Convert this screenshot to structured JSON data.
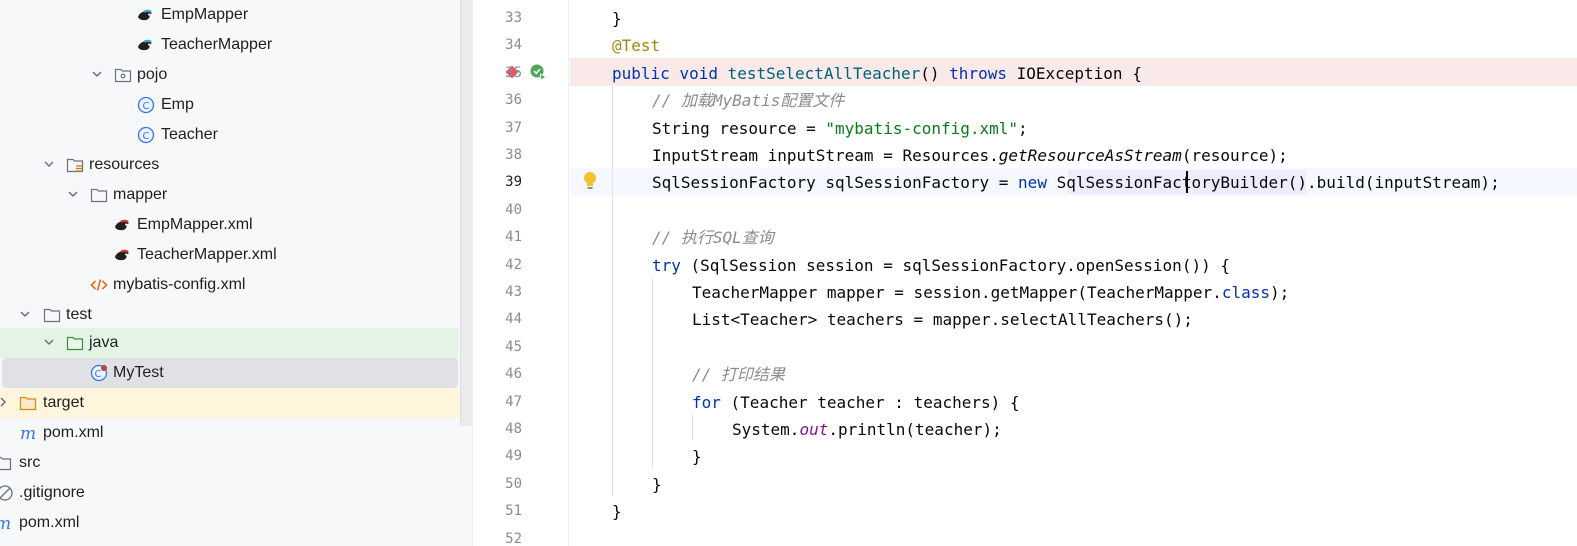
{
  "tree": {
    "items": [
      {
        "label": "EmpMapper",
        "icon": "mybatis-mapper-icon"
      },
      {
        "label": "TeacherMapper",
        "icon": "mybatis-mapper-icon"
      },
      {
        "label": "pojo",
        "icon": "package-icon"
      },
      {
        "label": "Emp",
        "icon": "class-icon"
      },
      {
        "label": "Teacher",
        "icon": "class-icon"
      },
      {
        "label": "resources",
        "icon": "resources-folder-icon"
      },
      {
        "label": "mapper",
        "icon": "folder-icon"
      },
      {
        "label": "EmpMapper.xml",
        "icon": "mybatis-xml-icon"
      },
      {
        "label": "TeacherMapper.xml",
        "icon": "mybatis-xml-icon"
      },
      {
        "label": "mybatis-config.xml",
        "icon": "xml-icon"
      },
      {
        "label": "test",
        "icon": "folder-icon"
      },
      {
        "label": "java",
        "icon": "test-sources-folder-icon"
      },
      {
        "label": "MyTest",
        "icon": "test-class-icon"
      },
      {
        "label": "target",
        "icon": "excluded-folder-icon"
      },
      {
        "label": "pom.xml",
        "icon": "maven-icon"
      },
      {
        "label": "src",
        "icon": "folder-icon"
      },
      {
        "label": ".gitignore",
        "icon": "ignore-file-icon"
      },
      {
        "label": "pom.xml",
        "icon": "maven-icon"
      }
    ]
  },
  "editor": {
    "line_numbers": [
      "33",
      "34",
      "35",
      "36",
      "37",
      "38",
      "39",
      "40",
      "41",
      "42",
      "43",
      "44",
      "45",
      "46",
      "47",
      "48",
      "49",
      "50",
      "51",
      "52"
    ],
    "current_line": "39",
    "lines": [
      {
        "t": [
          {
            "s": "}",
            "c": ""
          }
        ]
      },
      {
        "t": [
          {
            "s": "@Test",
            "c": "ann"
          }
        ]
      },
      {
        "t": [
          {
            "s": "public",
            "c": "kw"
          },
          {
            "s": " ",
            "c": ""
          },
          {
            "s": "void",
            "c": "kw"
          },
          {
            "s": " ",
            "c": ""
          },
          {
            "s": "testSelectAllTeacher",
            "c": "fn"
          },
          {
            "s": "() ",
            "c": ""
          },
          {
            "s": "throws",
            "c": "kw"
          },
          {
            "s": " IOException {",
            "c": ""
          }
        ]
      },
      {
        "t": [
          {
            "s": "// 加载MyBatis配置文件",
            "c": "cm"
          }
        ]
      },
      {
        "t": [
          {
            "s": "String resource = ",
            "c": ""
          },
          {
            "s": "\"mybatis-config.xml\"",
            "c": "str"
          },
          {
            "s": ";",
            "c": ""
          }
        ]
      },
      {
        "t": [
          {
            "s": "InputStream inputStream = Resources.",
            "c": ""
          },
          {
            "s": "getResourceAsStream",
            "c": "st"
          },
          {
            "s": "(resource);",
            "c": ""
          }
        ]
      },
      {
        "t": [
          {
            "s": "SqlSessionFactory sqlSessionFactory = ",
            "c": ""
          },
          {
            "s": "new",
            "c": "kw"
          },
          {
            "s": " SqlSessionFactoryBuilder().build(inputStream);",
            "c": ""
          }
        ]
      },
      {
        "t": []
      },
      {
        "t": [
          {
            "s": "// 执行SQL查询",
            "c": "cm"
          }
        ]
      },
      {
        "t": [
          {
            "s": "try",
            "c": "kw"
          },
          {
            "s": " (SqlSession session = sqlSessionFactory.openSession()) {",
            "c": ""
          }
        ]
      },
      {
        "t": [
          {
            "s": "TeacherMapper mapper = session.getMapper(TeacherMapper.",
            "c": ""
          },
          {
            "s": "class",
            "c": "kw"
          },
          {
            "s": ");",
            "c": ""
          }
        ]
      },
      {
        "t": [
          {
            "s": "List<Teacher> teachers = mapper.selectAllTeachers();",
            "c": ""
          }
        ]
      },
      {
        "t": []
      },
      {
        "t": [
          {
            "s": "// 打印结果",
            "c": "cm"
          }
        ]
      },
      {
        "t": [
          {
            "s": "for",
            "c": "kw"
          },
          {
            "s": " (Teacher teacher : teachers) {",
            "c": ""
          }
        ]
      },
      {
        "t": [
          {
            "s": "System.",
            "c": ""
          },
          {
            "s": "out",
            "c": "fld"
          },
          {
            "s": ".println(teacher);",
            "c": ""
          }
        ]
      },
      {
        "t": [
          {
            "s": "}",
            "c": ""
          }
        ]
      },
      {
        "t": [
          {
            "s": "}",
            "c": ""
          }
        ]
      },
      {
        "t": [
          {
            "s": "}",
            "c": ""
          }
        ]
      },
      {
        "t": []
      }
    ],
    "gutter_icons": [
      "breakpoint-icon",
      "run-test-icon",
      "intention-bulb-icon"
    ]
  }
}
